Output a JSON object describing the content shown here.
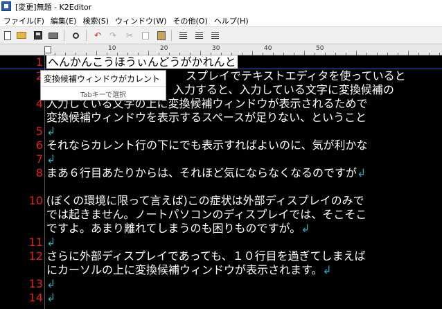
{
  "window": {
    "title": "[変更]無題 - K2Editor"
  },
  "menu": [
    "ファイル(F)",
    "編集(E)",
    "検索(S)",
    "ウィンドウ(W)",
    "その他(O)",
    "ヘルプ(H)"
  ],
  "toolbar": {
    "icons": [
      "new-file-icon",
      "open-folder-icon",
      "save-icon",
      "print-icon",
      "search-icon",
      "undo-icon",
      "redo-icon",
      "cut-icon",
      "copy-icon",
      "paste-icon",
      "align-left-icon",
      "align-center-icon",
      "align-right-icon"
    ],
    "undo_glyph": "↶",
    "redo_glyph": "↷",
    "cut_glyph": "✂"
  },
  "ruler": {
    "labels": [
      "10",
      "20",
      "30",
      "40",
      "50"
    ]
  },
  "editor": {
    "line_numbers": [
      "1",
      "2",
      "",
      "4",
      "5",
      "6",
      "7",
      "8",
      "",
      "10",
      "",
      "",
      "11",
      "12",
      "",
      "13",
      "14"
    ],
    "ime_text": "へんかんこうほうぃんどうがかれんと",
    "lines": [
      {
        "text": "",
        "mark": ""
      },
      {
        "text": "スプレイでテキストエディタを使っていると",
        "mark": ""
      },
      {
        "text": "入力すると、入力している文字に変換候補の",
        "mark": ""
      },
      {
        "text": "入力している文字の上に変換候補ウィンドウが表示されるためで",
        "mark": ""
      },
      {
        "text": "変換候補ウィンドウを表示するスペースが足りない、ということ",
        "mark": ""
      },
      {
        "text": "",
        "mark": "↲"
      },
      {
        "text": "それならカレント行の下にでも表示すればよいのに、気が利かな",
        "mark": ""
      },
      {
        "text": "",
        "mark": "↲"
      },
      {
        "text": "まあ６行目あたりからは、それほど気にならなくなるのですが",
        "mark": "↲"
      },
      {
        "text": "",
        "mark": ""
      },
      {
        "text": "(ぼくの環境に限って言えば)この症状は外部ディスプレイのみで",
        "mark": ""
      },
      {
        "text": "では起きません。ノートパソコンのディスプレイでは、そこそこ",
        "mark": ""
      },
      {
        "text": "ですよ。あまり離れてしまうのも困りものですが。",
        "mark": "↲"
      },
      {
        "text": "",
        "mark": "↲"
      },
      {
        "text": "さらに外部ディスプレイであっても、１０行目を過ぎてしまえば",
        "mark": ""
      },
      {
        "text": "にカーソルの上に変換候補ウィンドウが表示されます。",
        "mark": "↲"
      },
      {
        "text": "",
        "mark": "↲"
      },
      {
        "text": "",
        "mark": "↲"
      }
    ],
    "candidate": {
      "item": "変換候補ウィンドウがカレント",
      "hint": "Tabキーで選択"
    }
  }
}
